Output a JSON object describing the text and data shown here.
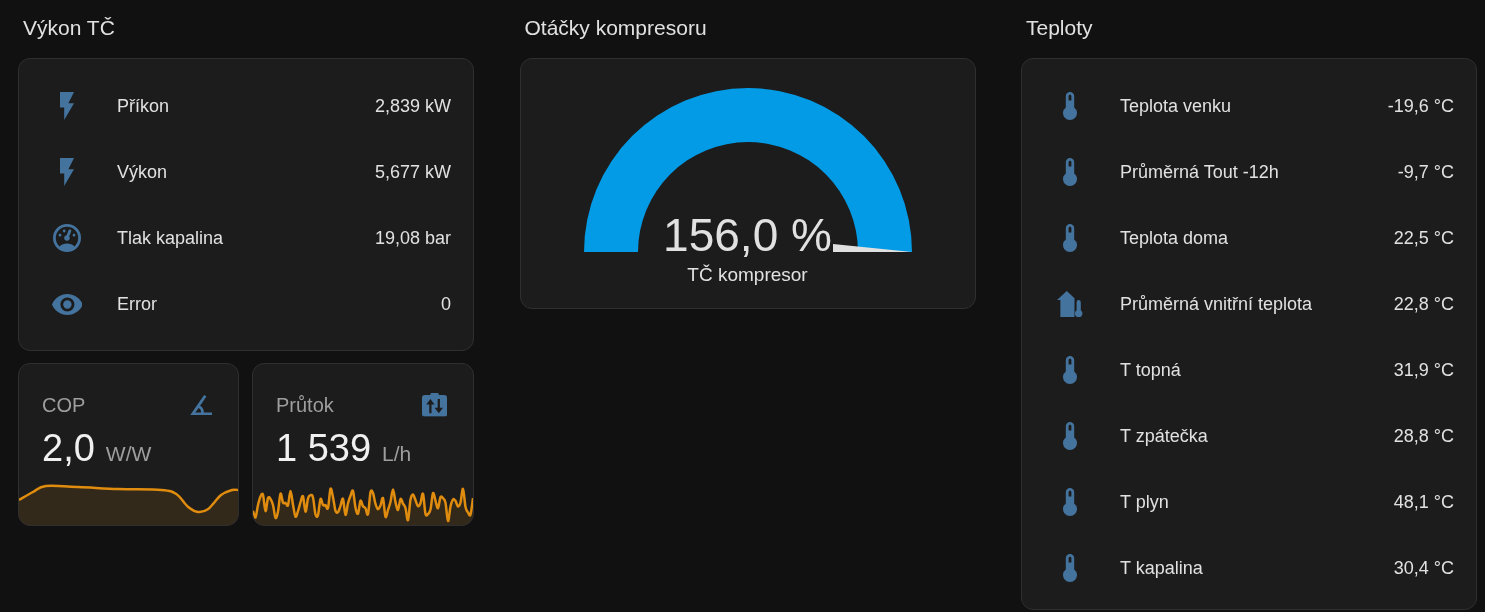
{
  "power": {
    "title": "Výkon TČ",
    "entities": [
      {
        "kind": "power",
        "name": "Příkon",
        "value": "2,839 kW"
      },
      {
        "kind": "power",
        "name": "Výkon",
        "value": "5,677 kW"
      },
      {
        "kind": "pressure",
        "name": "Tlak kapalina",
        "value": "19,08 bar"
      },
      {
        "kind": "error",
        "name": "Error",
        "value": "0"
      }
    ],
    "tiles": [
      {
        "kind": "ratio",
        "name": "COP",
        "value": "2,0",
        "unit": "W/W"
      },
      {
        "kind": "flow",
        "name": "Průtok",
        "value": "1 539",
        "unit": "L/h"
      }
    ]
  },
  "compressor": {
    "title": "Otáčky kompresoru",
    "gauge": {
      "value": "156,0 %",
      "name": "TČ kompresor",
      "level": 1
    }
  },
  "temperatures": {
    "title": "Teploty",
    "entities": [
      {
        "kind": "temperature",
        "name": "Teplota venku",
        "value": "-19,6 °C"
      },
      {
        "kind": "temperature",
        "name": "Průměrná Tout -12h",
        "value": "-9,7 °C"
      },
      {
        "kind": "temperature",
        "name": "Teplota doma",
        "value": "22,5 °C"
      },
      {
        "kind": "indoor",
        "name": "Průměrná vnitřní teplota",
        "value": "22,8 °C"
      },
      {
        "kind": "temperature",
        "name": "T topná",
        "value": "31,9 °C"
      },
      {
        "kind": "temperature",
        "name": "T zpátečka",
        "value": "28,8 °C"
      },
      {
        "kind": "temperature",
        "name": "T plyn",
        "value": "48,1 °C"
      },
      {
        "kind": "temperature",
        "name": "T kapalina",
        "value": "30,4 °C"
      }
    ]
  }
}
